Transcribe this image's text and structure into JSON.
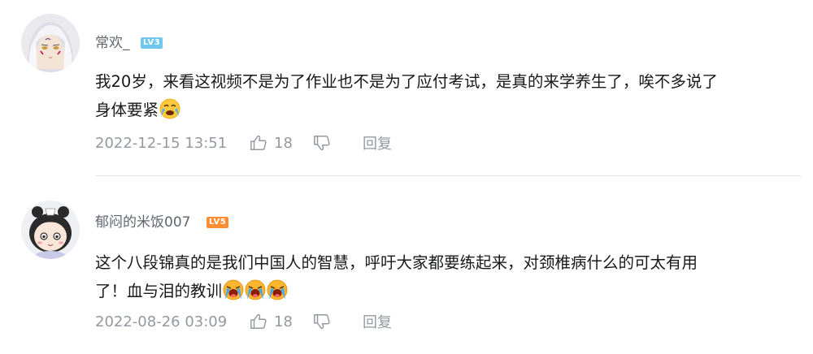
{
  "comments": [
    {
      "username": "常欢_",
      "level": "LV3",
      "content_line1": "我20岁，来看这视频不是为了作业也不是为了应付考试，是真的来学养生了，唉不多说了",
      "content_line2": "身体要紧",
      "emoji": "crying-emoji",
      "time": "2022-12-15 13:51",
      "likes": "18",
      "reply_label": "回复"
    },
    {
      "username": "郁闷的米饭007",
      "level": "LV5",
      "content_line1": "这个八段锦真的是我们中国人的智慧，呼吁大家都要练起来，对颈椎病什么的可太有用",
      "content_line2": "了！血与泪的教训",
      "emoji": "loud-crying-emoji",
      "emoji_count": 3,
      "time": "2022-08-26 03:09",
      "likes": "18",
      "reply_label": "回复"
    }
  ],
  "colors": {
    "text": "#18191c",
    "username": "#61666d",
    "meta": "#9499a0",
    "level3": "#6fc7f0",
    "level5": "#ff8c33",
    "divider": "#e3e5e7"
  }
}
